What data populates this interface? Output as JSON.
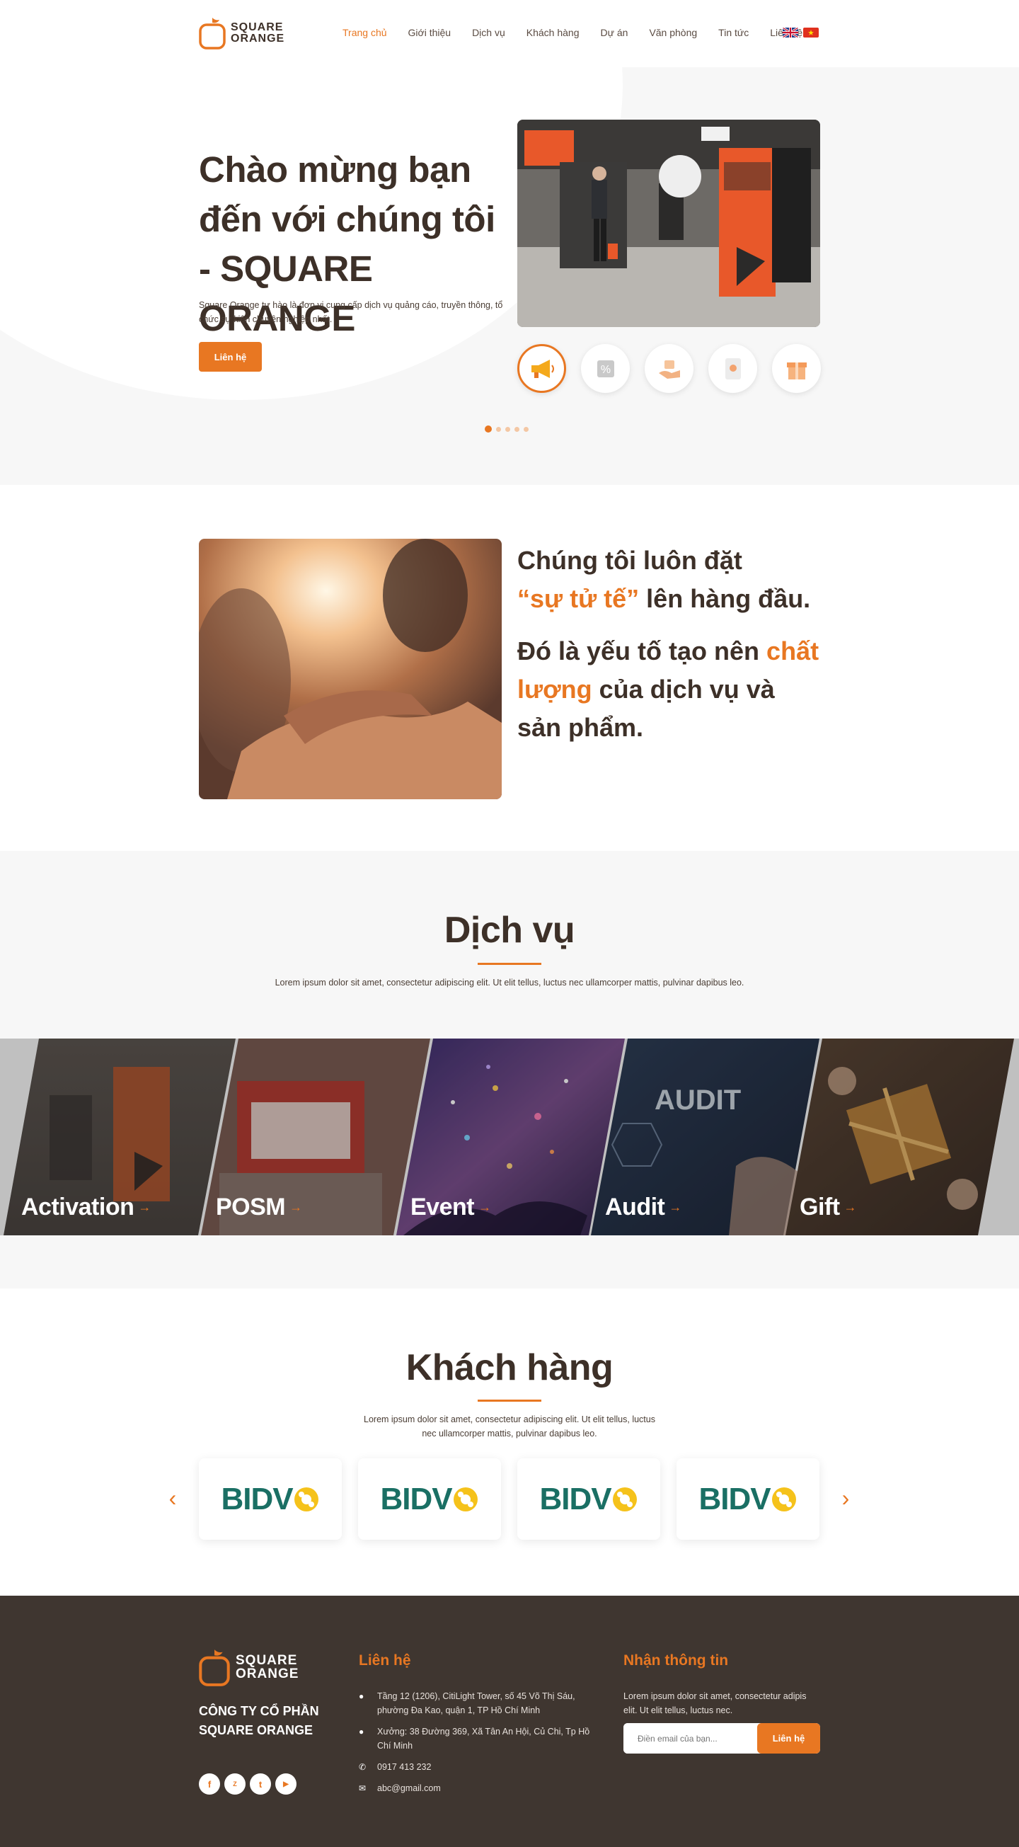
{
  "header": {
    "logo_line1": "SQUARE",
    "logo_line2": "ORANGE",
    "nav": [
      {
        "label": "Trang chủ"
      },
      {
        "label": "Giới thiệu"
      },
      {
        "label": "Dịch vụ"
      },
      {
        "label": "Khách hàng"
      },
      {
        "label": "Dự án"
      },
      {
        "label": "Văn phòng"
      },
      {
        "label": "Tin tức"
      },
      {
        "label": "Liên hệ"
      }
    ],
    "languages": [
      "flag-uk-icon",
      "flag-vietnam-icon"
    ]
  },
  "hero": {
    "title": "Chào mừng bạn đến với chúng tôi - SQUARE ORANGE",
    "description": "Square Orange tự hào là đơn vị cung cấp dịch vụ quảng cáo, truyền thông, tổ chức sự kiện chuyên nghiệp nhất.",
    "button_label": "Liên hệ",
    "service_icons": [
      "megaphone-icon",
      "discount-tag-icon",
      "hand-gift-icon",
      "document-icon",
      "gift-box-icon"
    ],
    "active_slide": 1,
    "slide_count": 5
  },
  "values": {
    "line1a": "Chúng tôi luôn đặt",
    "line1_highlight": "“sự tử tế”",
    "line1b": " lên hàng đầu.",
    "line2a": "Đó là yếu tố tạo nên ",
    "line2_highlight": "chất lượng",
    "line2b": " của dịch vụ và sản phẩm."
  },
  "services": {
    "title": "Dịch vụ",
    "description": "Lorem ipsum dolor sit amet, consectetur adipiscing elit. Ut elit tellus, luctus nec ullamcorper mattis, pulvinar dapibus leo.",
    "items": [
      {
        "label": "Activation"
      },
      {
        "label": "POSM"
      },
      {
        "label": "Event"
      },
      {
        "label": "Audit"
      },
      {
        "label": "Gift"
      }
    ],
    "audit_image_text": "AUDIT"
  },
  "clients": {
    "title": "Khách hàng",
    "description_line1": "Lorem ipsum dolor sit amet, consectetur adipiscing elit. Ut elit tellus, luctus",
    "description_line2": "nec ullamcorper mattis, pulvinar dapibus leo.",
    "logos": [
      {
        "name": "BIDV"
      },
      {
        "name": "BIDV"
      },
      {
        "name": "BIDV"
      },
      {
        "name": "BIDV"
      }
    ]
  },
  "footer": {
    "logo_line1": "SQUARE",
    "logo_line2": "ORANGE",
    "company_line1": "CÔNG TY CỔ PHẦN",
    "company_line2": "SQUARE ORANGE",
    "contact_heading": "Liên hệ",
    "address1": "Tầng 12 (1206), CitiLight Tower, số 45 Võ Thị Sáu, phường Đa Kao, quận 1, TP Hồ Chí Minh",
    "address2": "Xưởng: 38 Đường 369, Xã Tân An Hội, Củ Chi, Tp Hồ Chí Minh",
    "phone": "0917 413 232",
    "email": "abc@gmail.com",
    "newsletter_heading": "Nhận thông tin",
    "newsletter_desc": "Lorem ipsum dolor sit amet, consectetur adipis elit. Ut elit tellus, luctus nec.",
    "email_placeholder": "Điền email của bạn...",
    "subscribe_label": "Liên hệ",
    "socials": [
      "facebook-icon",
      "zalo-icon",
      "twitter-icon",
      "youtube-icon"
    ]
  },
  "colors": {
    "accent": "#e87722",
    "dark": "#3d3028",
    "footer_bg": "#3f3630"
  }
}
